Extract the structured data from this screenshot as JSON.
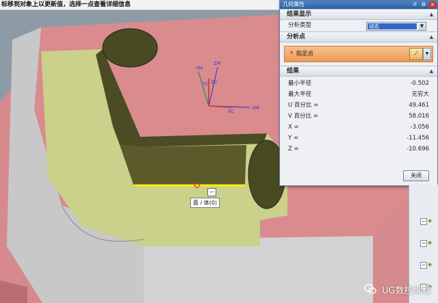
{
  "status_prompt": "标移到对象上以更新值，选择一点查看详细信息",
  "dialog": {
    "title": "几何属性",
    "results_display": {
      "header": "结果显示",
      "analysis_type_label": "分析类型",
      "analysis_type_value": "动态"
    },
    "analysis_point": {
      "header": "分析点",
      "specify_point_label": "指定点"
    },
    "results": {
      "header": "结果",
      "rows": [
        {
          "label": "最小半径",
          "value": "-0.502"
        },
        {
          "label": "最大半径",
          "value": "无穷大"
        },
        {
          "label": "U 百分比 =",
          "value": "49.461"
        },
        {
          "label": "V 百分比 =",
          "value": "58.016"
        },
        {
          "label": "X =",
          "value": "-3.056"
        },
        {
          "label": "Y =",
          "value": "-11.456"
        },
        {
          "label": "Z =",
          "value": "-10.696"
        }
      ]
    },
    "close_label": "关闭"
  },
  "viewport": {
    "axes": {
      "y_label": "YM",
      "z_label": "ZM",
      "x_label": "XM",
      "xc_label": "XC",
      "yc_label": "YC",
      "zc_label": "ZC"
    },
    "tooltip": "面 / 体(0)"
  },
  "watermark": "UG数控编程",
  "colors": {
    "pink_surface": "#d98b8d",
    "olive_face": "#cfd28a",
    "dark_olive": "#4a4a22",
    "gray_wall": "#c9c9c9",
    "selection_edge": "#ffee00",
    "title_bar": "#3a70b5",
    "point_row": "#ef9f5e"
  }
}
